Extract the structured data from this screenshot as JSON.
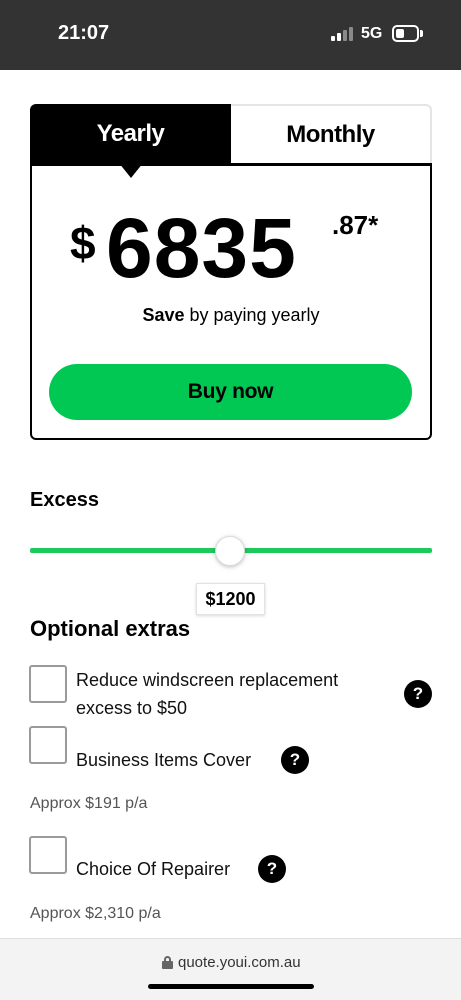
{
  "status_bar": {
    "time": "21:07",
    "network": "5G"
  },
  "pricing": {
    "tabs": [
      {
        "label": "Yearly",
        "selected": true
      },
      {
        "label": "Monthly",
        "selected": false
      }
    ],
    "currency": "$",
    "amount": "6835",
    "cents": ".87*",
    "save_bold": "Save",
    "save_rest": " by paying yearly",
    "buy_label": "Buy now"
  },
  "excess": {
    "title": "Excess",
    "value_label": "$1200"
  },
  "extras": {
    "title": "Optional extras",
    "items": [
      {
        "label_line1": "Reduce windscreen replacement",
        "label_line2": "excess to $50",
        "approx": ""
      },
      {
        "label_line1": "Business Items Cover",
        "label_line2": "",
        "approx": "Approx $191 p/a"
      },
      {
        "label_line1": "Choice Of Repairer",
        "label_line2": "",
        "approx": "Approx $2,310 p/a"
      }
    ],
    "help_glyph": "?"
  },
  "browser": {
    "url": "quote.youi.com.au"
  },
  "colors": {
    "accent_green": "#00c853",
    "status_bar": "#333333"
  },
  "icons": [
    "signal-icon",
    "battery-icon",
    "help-icon",
    "lock-icon"
  ]
}
